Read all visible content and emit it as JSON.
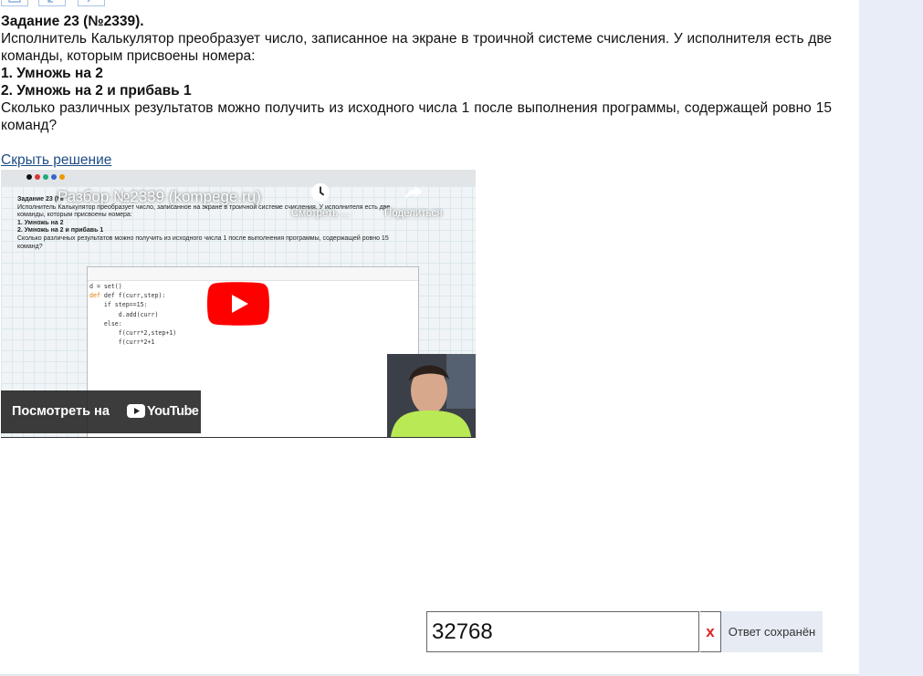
{
  "task": {
    "title": "Задание 23 (№2339).",
    "intro": " Исполнитель Калькулятор преобразует число, записанное на экране в троичной системе счисления. У исполнителя есть две команды, которым присвоены номера:",
    "commands": [
      "1. Умножь на 2",
      "2. Умножь на 2 и прибавь 1"
    ],
    "question": "Сколько различных результатов можно получить из исходного числа 1 после выполнения программы, содержащей ровно 15 команд?"
  },
  "solution_toggle": "Скрыть решение",
  "video": {
    "title": "Разбор №2339 (kompege.ru)",
    "watch_later": "Смотреть ...",
    "share": "Поделиться",
    "watch_on": "Посмотреть на",
    "youtube": "YouTube",
    "inner": {
      "title": "Задание 23 (№",
      "intro": " Исполнитель Калькулятор преобразует число, записанное на экране в троичной системе счисления. У исполнителя есть две команды, которым присвоены номера:",
      "cmd1": "1. Умножь на 2",
      "cmd2": "2. Умножь на 2 и прибавь 1",
      "question": "Сколько различных результатов можно получить из исходного числа 1 после выполнения программы, содержащей ровно 15 команд?"
    },
    "code": [
      "d = set()",
      "def f(curr,step):",
      "    if step==15:",
      "        d.add(curr)",
      "    else:",
      "        f(curr*2,step+1)",
      "        f(curr*2+1"
    ]
  },
  "answer": {
    "value": "32768",
    "clear_label": "x",
    "status": "Ответ сохранён"
  },
  "colors": {
    "link": "#1f4e86",
    "status_bg": "#e6ebf4",
    "side_panel": "#e9edf7",
    "youtube_red": "#ff0000"
  }
}
